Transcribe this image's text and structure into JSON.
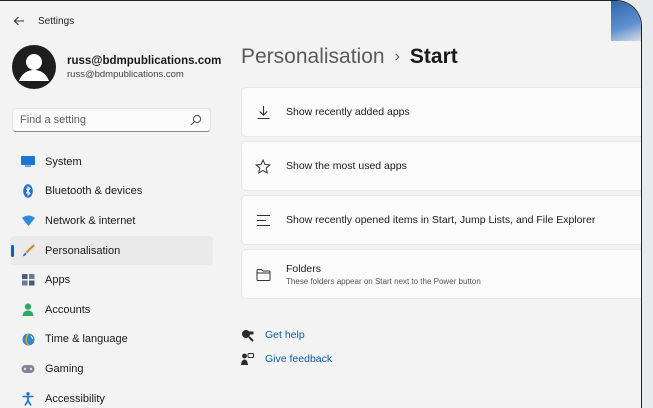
{
  "window": {
    "title": "Settings"
  },
  "profile": {
    "name": "russ@bdmpublications.com",
    "email": "russ@bdmpublications.com"
  },
  "search": {
    "placeholder": "Find a setting"
  },
  "sidebar": {
    "items": [
      {
        "label": "System",
        "icon": "system-icon"
      },
      {
        "label": "Bluetooth & devices",
        "icon": "bluetooth-icon"
      },
      {
        "label": "Network & internet",
        "icon": "network-icon"
      },
      {
        "label": "Personalisation",
        "icon": "personalisation-icon",
        "active": true
      },
      {
        "label": "Apps",
        "icon": "apps-icon"
      },
      {
        "label": "Accounts",
        "icon": "accounts-icon"
      },
      {
        "label": "Time & language",
        "icon": "time-language-icon"
      },
      {
        "label": "Gaming",
        "icon": "gaming-icon"
      },
      {
        "label": "Accessibility",
        "icon": "accessibility-icon"
      }
    ]
  },
  "header": {
    "parent": "Personalisation",
    "separator": "›",
    "current": "Start"
  },
  "settings": [
    {
      "label": "Show recently added apps",
      "icon": "download-icon"
    },
    {
      "label": "Show the most used apps",
      "icon": "star-icon"
    },
    {
      "label": "Show recently opened items in Start, Jump Lists, and File Explorer",
      "icon": "list-icon"
    },
    {
      "label": "Folders",
      "sublabel": "These folders appear on Start next to the Power button",
      "icon": "folder-icon"
    }
  ],
  "links": [
    {
      "label": "Get help",
      "icon": "help-icon"
    },
    {
      "label": "Give feedback",
      "icon": "feedback-icon"
    }
  ],
  "colors": {
    "accent": "#0067c0",
    "link": "#0b5cad",
    "background": "#f3f3f3",
    "card": "#fbfbfb"
  }
}
